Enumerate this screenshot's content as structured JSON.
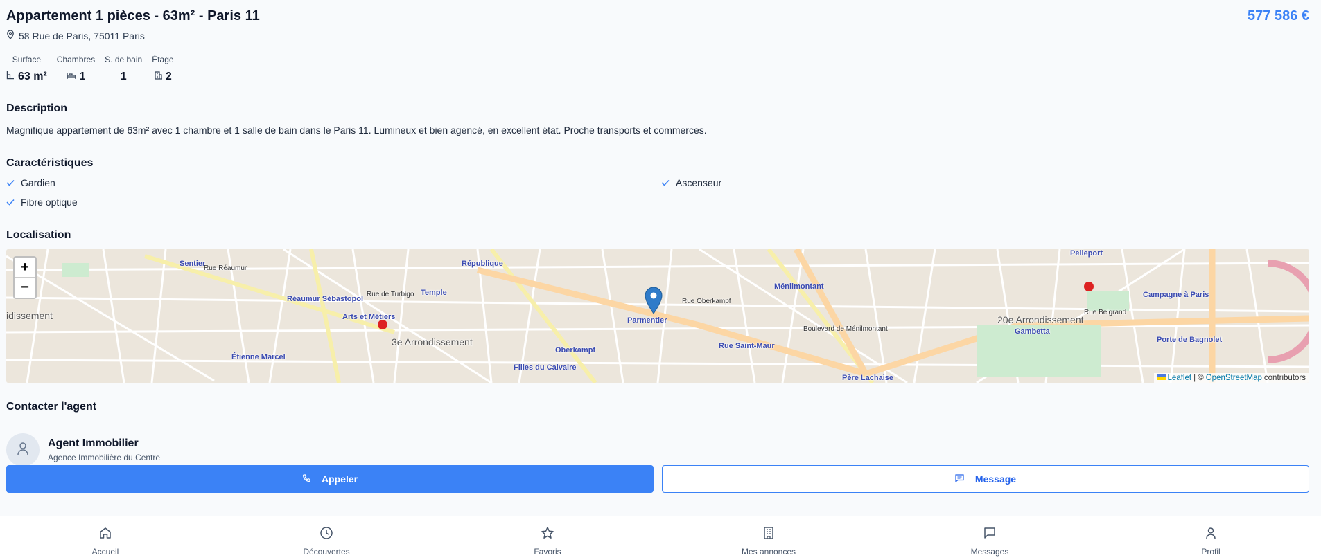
{
  "listing": {
    "title": "Appartement 1 pièces - 63m² - Paris 11",
    "price": "577 586 €",
    "address": "58 Rue de Paris, 75011 Paris"
  },
  "specs": [
    {
      "label": "Surface",
      "value": "63 m²",
      "icon": "floor-area-icon"
    },
    {
      "label": "Chambres",
      "value": "1",
      "icon": "bed-icon"
    },
    {
      "label": "S. de bain",
      "value": "1",
      "icon": ""
    },
    {
      "label": "Étage",
      "value": "2",
      "icon": "building-icon"
    }
  ],
  "description": {
    "title": "Description",
    "text": "Magnifique appartement de 63m² avec 1 chambre et 1 salle de bain dans le Paris 11. Lumineux et bien agencé, en excellent état. Proche transports et commerces."
  },
  "features": {
    "title": "Caractéristiques",
    "items": [
      "Gardien",
      "Ascenseur",
      "Fibre optique"
    ]
  },
  "location": {
    "title": "Localisation",
    "zoom_in": "+",
    "zoom_out": "−",
    "attribution_leaflet": "Leaflet",
    "attribution_sep": "| ©",
    "attribution_osm": "OpenStreetMap",
    "attribution_suffix": "contributors",
    "map_labels": [
      "République",
      "Temple",
      "Réaumur Sébastopol",
      "Arts et Métiers",
      "3e Arrondissement",
      "Parmentier",
      "Oberkampf",
      "Filles du Calvaire",
      "Rue Saint-Maur",
      "Ménilmontant",
      "Père Lachaise",
      "20e Arrondissement",
      "Gambetta",
      "Pelleport",
      "Campagne à Paris",
      "Porte de Bagnolet",
      "Étienne Marcel",
      "Sentier",
      "Rue Réaumur",
      "Rue de Turbigo",
      "Rue Oberkampf",
      "Boulevard de Ménilmontant",
      "Rue Belgrand",
      "idissement"
    ]
  },
  "contact": {
    "title": "Contacter l'agent",
    "agent_name": "Agent Immobilier",
    "agency": "Agence Immobilière du Centre",
    "call_label": "Appeler",
    "message_label": "Message"
  },
  "nav": [
    {
      "label": "Accueil",
      "icon": "home-icon"
    },
    {
      "label": "Découvertes",
      "icon": "clock-icon"
    },
    {
      "label": "Favoris",
      "icon": "star-icon"
    },
    {
      "label": "Mes annonces",
      "icon": "building-icon"
    },
    {
      "label": "Messages",
      "icon": "chat-icon"
    },
    {
      "label": "Profil",
      "icon": "user-icon"
    }
  ],
  "colors": {
    "accent": "#3b82f6",
    "price": "#3b82f6",
    "marker": "#2f7bc9"
  }
}
